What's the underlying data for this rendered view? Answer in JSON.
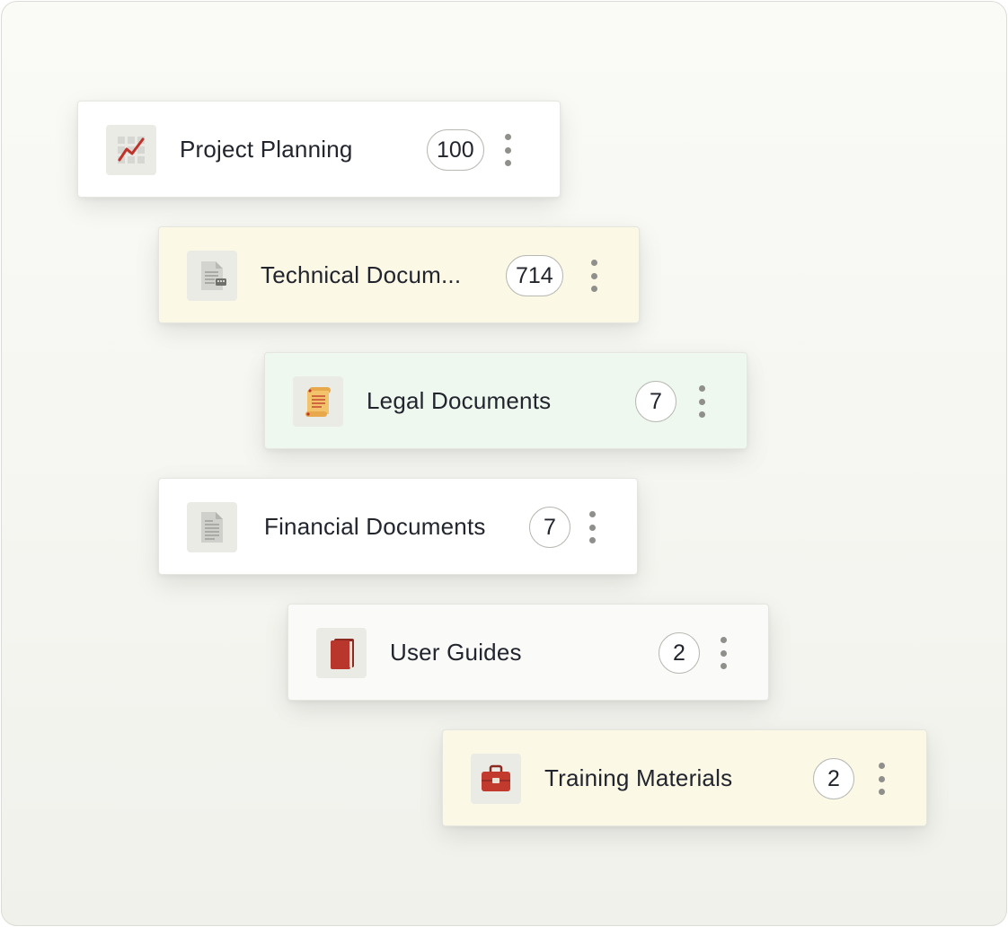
{
  "folders": [
    {
      "label": "Project Planning",
      "count": "100",
      "icon": "chart-trend-icon",
      "background": "#ffffff"
    },
    {
      "label": "Technical Docum...",
      "count": "714",
      "icon": "technical-document-icon",
      "background": "#fbf8e6"
    },
    {
      "label": "Legal Documents",
      "count": "7",
      "icon": "scroll-icon",
      "background": "#eff8ef"
    },
    {
      "label": "Financial Documents",
      "count": "7",
      "icon": "document-icon",
      "background": "#ffffff"
    },
    {
      "label": "User Guides",
      "count": "2",
      "icon": "book-icon",
      "background": "#fafaf8"
    },
    {
      "label": "Training Materials",
      "count": "2",
      "icon": "briefcase-icon",
      "background": "#fbf8e6"
    }
  ],
  "colors": {
    "chart_red": "#c0332a",
    "book_red": "#b8362b",
    "scroll_yellow": "#f2c36a",
    "doc_gray": "#cfcfcb"
  }
}
